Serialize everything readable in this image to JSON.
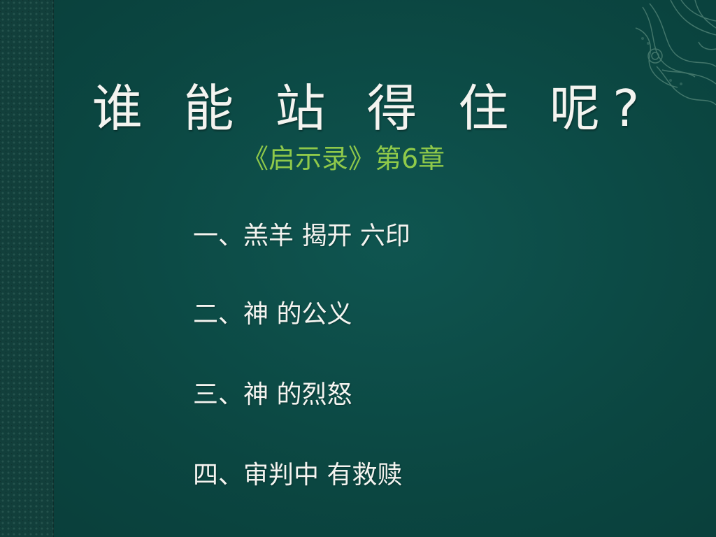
{
  "slide": {
    "title": "谁 能 站 得 住 呢?",
    "subtitle": "《启示录》第6章",
    "points": [
      "一、羔羊 揭开 六印",
      "二、神 的公义",
      "三、神 的烈怒",
      "四、审判中 有救赎"
    ]
  },
  "colors": {
    "background": "#0c4a45",
    "title": "#f4f4f0",
    "subtitle": "#8fc94a"
  },
  "icons": {
    "corner_ornament": "phoenix-ornament-icon"
  }
}
